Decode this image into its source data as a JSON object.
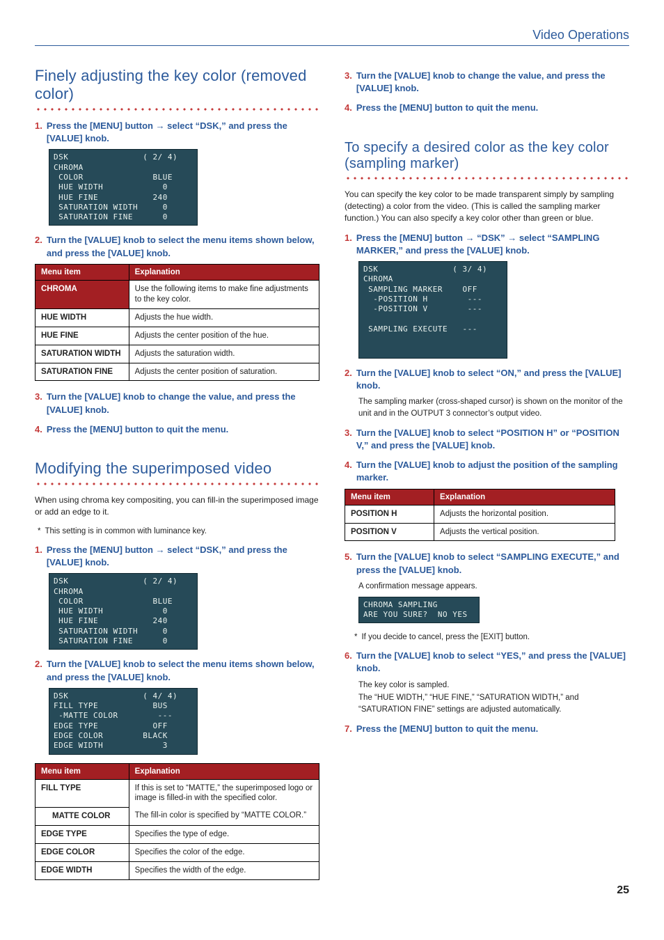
{
  "header": {
    "title": "Video Operations"
  },
  "pageNumber": "25",
  "left": {
    "sec1": {
      "title": "Finely adjusting the key color (removed color)",
      "step1": {
        "num": "1.",
        "text": "Press the [MENU] button → select “DSK,” and press the [VALUE] knob."
      },
      "lcd1": "DSK               ( 2/ 4)\nCHROMA\n COLOR              BLUE\n HUE WIDTH            0\n HUE FINE           240\n SATURATION WIDTH     0\n SATURATION FINE      0",
      "step2": {
        "num": "2.",
        "text": "Turn the [VALUE] knob to select the menu items shown below, and press the [VALUE] knob."
      },
      "table1": {
        "head": {
          "c1": "Menu item",
          "c2": "Explanation"
        },
        "rows": [
          {
            "label": "CHROMA",
            "red": true,
            "desc": "Use the following items to make fine adjustments to the key color."
          },
          {
            "label": "HUE WIDTH",
            "desc": "Adjusts the hue width."
          },
          {
            "label": "HUE FINE",
            "desc": "Adjusts the center position of the hue."
          },
          {
            "label": "SATURATION WIDTH",
            "desc": "Adjusts the saturation width."
          },
          {
            "label": "SATURATION FINE",
            "desc": "Adjusts the center position of saturation."
          }
        ]
      },
      "step3": {
        "num": "3.",
        "text": "Turn the [VALUE] knob to change the value, and press the [VALUE] knob."
      },
      "step4": {
        "num": "4.",
        "text": "Press the [MENU] button to quit the menu."
      }
    },
    "sec2": {
      "title": "Modifying the superimposed video",
      "intro": "When using chroma key compositing, you can fill-in the superimposed image or add an edge to it.",
      "note": "This setting is in common with luminance key.",
      "step1": {
        "num": "1.",
        "text": "Press the [MENU] button → select “DSK,” and press the [VALUE] knob."
      },
      "lcd1": "DSK               ( 2/ 4)\nCHROMA\n COLOR              BLUE\n HUE WIDTH            0\n HUE FINE           240\n SATURATION WIDTH     0\n SATURATION FINE      0",
      "step2": {
        "num": "2.",
        "text": "Turn the [VALUE] knob to select the menu items shown below, and press the [VALUE] knob."
      },
      "lcd2": "DSK               ( 4/ 4)\nFILL TYPE           BUS\n -MATTE COLOR        ---\nEDGE TYPE           OFF\nEDGE COLOR        BLACK\nEDGE WIDTH            3",
      "table2": {
        "head": {
          "c1": "Menu item",
          "c2": "Explanation"
        },
        "rows": [
          {
            "label": "FILL TYPE",
            "desc": "If this is set to “MATTE,” the superimposed logo or image is filled-in with the specified color."
          },
          {
            "label": "MATTE COLOR",
            "sub": true,
            "desc": "The fill-in color is specified by “MATTE COLOR.”"
          },
          {
            "label": "EDGE TYPE",
            "desc": "Specifies the type of edge."
          },
          {
            "label": "EDGE COLOR",
            "desc": "Specifies the color of the edge."
          },
          {
            "label": "EDGE WIDTH",
            "desc": "Specifies the width of the edge."
          }
        ]
      }
    }
  },
  "right": {
    "step3top": {
      "num": "3.",
      "text": "Turn the [VALUE] knob to change the value, and press the [VALUE] knob."
    },
    "step4top": {
      "num": "4.",
      "text": "Press the [MENU] button to quit the menu."
    },
    "sec3": {
      "title": "To specify a desired color as the key color (sampling marker)",
      "intro": "You can specify the key color to be made transparent simply by sampling (detecting) a color from the video. (This is called the sampling marker function.) You can also specify a key color other than green or blue.",
      "step1": {
        "num": "1.",
        "text": "Press the [MENU] button → “DSK” → select “SAMPLING MARKER,” and press the [VALUE] knob."
      },
      "lcd1": "DSK               ( 3/ 4)\nCHROMA\n SAMPLING MARKER    OFF\n  -POSITION H        ---\n  -POSITION V        ---\n\n SAMPLING EXECUTE   ---\n\n\n",
      "step2": {
        "num": "2.",
        "text": "Turn the [VALUE] knob to select “ON,” and press the [VALUE] knob."
      },
      "step2sub": "The sampling marker (cross-shaped cursor) is shown on the monitor of the unit and in the OUTPUT 3 connector’s output video.",
      "step3": {
        "num": "3.",
        "text": "Turn the [VALUE] knob to select “POSITION H” or “POSITION V,” and press the [VALUE] knob."
      },
      "step4": {
        "num": "4.",
        "text": "Turn the [VALUE] knob to adjust the position of the sampling marker."
      },
      "table3": {
        "head": {
          "c1": "Menu item",
          "c2": "Explanation"
        },
        "rows": [
          {
            "label": "POSITION H",
            "desc": "Adjusts the horizontal position."
          },
          {
            "label": "POSITION V",
            "desc": "Adjusts the vertical position."
          }
        ]
      },
      "step5": {
        "num": "5.",
        "text": "Turn the [VALUE] knob to select “SAMPLING EXECUTE,” and press the [VALUE] knob."
      },
      "step5sub": "A confirmation message appears.",
      "lcd2": "CHROMA SAMPLING\nARE YOU SURE?  NO YES",
      "note5": "If you decide to cancel, press the [EXIT] button.",
      "step6": {
        "num": "6.",
        "text": "Turn the [VALUE] knob to select “YES,” and press the [VALUE] knob."
      },
      "step6sub1": "The key color is sampled.",
      "step6sub2": "The “HUE WIDTH,” “HUE FINE,” “SATURATION WIDTH,” and “SATURATION FINE” settings are adjusted automatically.",
      "step7": {
        "num": "7.",
        "text": "Press the [MENU] button to quit the menu."
      }
    }
  }
}
